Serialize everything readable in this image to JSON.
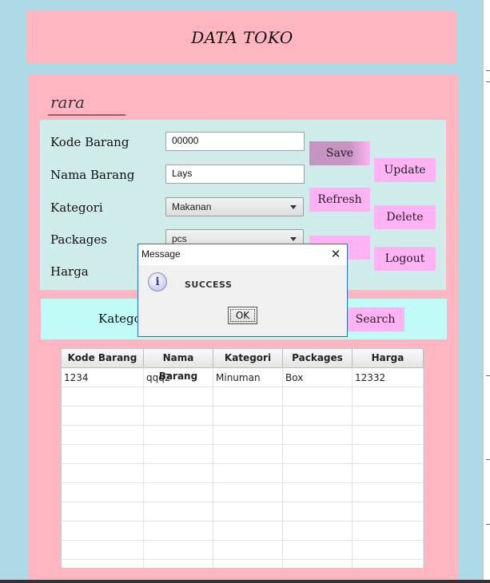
{
  "window": {
    "title": "DATA TOKO"
  },
  "user": {
    "name": "rara"
  },
  "form": {
    "kode_label": "Kode Barang",
    "kode_value": "00000",
    "nama_label": "Nama Barang",
    "nama_value": "Lays",
    "kategori_label": "Kategori",
    "kategori_value": "Makanan",
    "packages_label": "Packages",
    "packages_value": "pcs",
    "harga_label": "Harga"
  },
  "buttons": {
    "save": "Save",
    "update": "Update",
    "refresh": "Refresh",
    "delete": "Delete",
    "logout": "Logout",
    "search": "Search"
  },
  "search": {
    "label": "Kategori"
  },
  "table": {
    "columns": [
      "Kode Barang",
      "Nama Barang",
      "Kategori",
      "Packages",
      "Harga"
    ],
    "rows": [
      [
        "1234",
        "qqq2",
        "Minuman",
        "Box",
        "12332"
      ]
    ]
  },
  "dialog": {
    "title": "Message",
    "close_icon": "close-icon",
    "icon": "info-icon",
    "message": "SUCCESS",
    "ok_label": "OK"
  },
  "colors": {
    "background": "#add8e6",
    "panel_pink": "#ffb6c1",
    "form_panel": "#cfecea",
    "search_panel": "#c0fbf8",
    "button_pink": "#ffb3f5",
    "save_button_active": "#c694c1"
  }
}
